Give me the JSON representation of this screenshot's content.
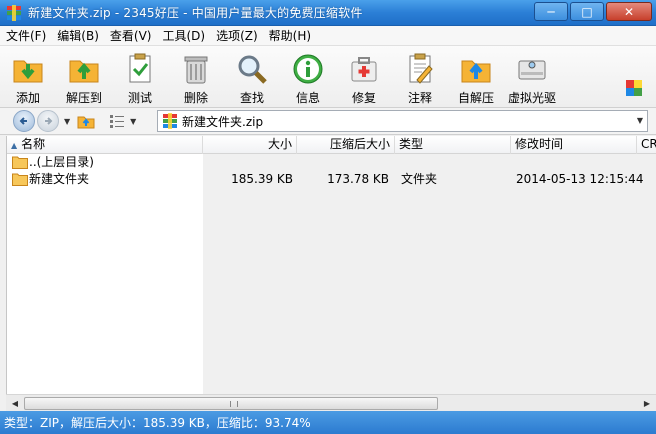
{
  "window": {
    "title": "新建文件夹.zip - 2345好压 - 中国用户量最大的免费压缩软件",
    "minimize_glyph": "─",
    "maximize_glyph": "□",
    "close_glyph": "✕"
  },
  "menu": [
    "文件(F)",
    "编辑(B)",
    "查看(V)",
    "工具(D)",
    "选项(Z)",
    "帮助(H)"
  ],
  "toolbar": [
    {
      "label": "添加",
      "icon": "add-icon"
    },
    {
      "label": "解压到",
      "icon": "extract-to-icon"
    },
    {
      "label": "测试",
      "icon": "test-icon"
    },
    {
      "label": "删除",
      "icon": "delete-icon"
    },
    {
      "label": "查找",
      "icon": "find-icon"
    },
    {
      "label": "信息",
      "icon": "info-icon"
    },
    {
      "label": "修复",
      "icon": "repair-icon"
    },
    {
      "label": "注释",
      "icon": "comment-icon"
    },
    {
      "label": "自解压",
      "icon": "self-extract-icon"
    },
    {
      "label": "虚拟光驱",
      "icon": "virtual-drive-icon"
    }
  ],
  "address": {
    "path": "新建文件夹.zip"
  },
  "columns": [
    "名称",
    "大小",
    "压缩后大小",
    "类型",
    "修改时间",
    "CRC"
  ],
  "rows": [
    {
      "name": "..(上层目录)",
      "size": "",
      "packed": "",
      "type": "",
      "modified": ""
    },
    {
      "name": "新建文件夹",
      "size": "185.39 KB",
      "packed": "173.78 KB",
      "type": "文件夹",
      "modified": "2014-05-13 12:15:44"
    }
  ],
  "status": "类型：ZIP，解压后大小：185.39 KB，压缩比：93.74%",
  "colors": {
    "titlebar": "#2b7fd6",
    "statusbar": "#3a8bd9"
  }
}
